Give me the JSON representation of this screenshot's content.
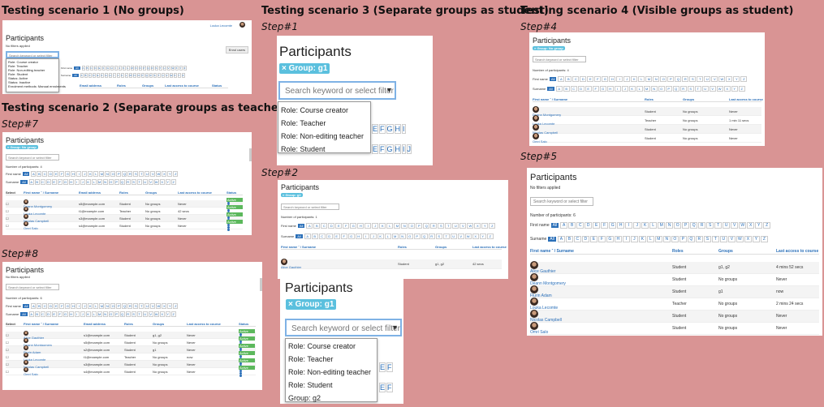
{
  "headings": {
    "s1": "Testing scenario 1 (No groups)",
    "s2": "Testing scenario 2 (Separate groups as teacher)",
    "s3": "Testing scenario 3 (Separate groups as student)",
    "s4": "Testing scenario 4 (Visible groups as student)"
  },
  "steps": {
    "s1": "Step#1",
    "s2": "Step#2",
    "s4": "Step#4",
    "s5": "Step#5",
    "s7": "Step#7",
    "s8": "Step#8"
  },
  "common": {
    "title": "Participants",
    "search_placeholder": "Search keyword or select filter",
    "no_filters": "No filters applied",
    "first_name": "First name",
    "surname": "Surname",
    "all": "All",
    "letters": [
      "A",
      "B",
      "C",
      "D",
      "E",
      "F",
      "G",
      "H",
      "I",
      "J",
      "K",
      "L",
      "M",
      "N",
      "O",
      "P",
      "Q",
      "R",
      "S",
      "T",
      "U",
      "V",
      "W",
      "X",
      "Y",
      "Z"
    ],
    "col_select": "Select",
    "col_name": "First name ˆ / Surname",
    "col_email": "Email address",
    "col_roles": "Roles",
    "col_groups": "Groups",
    "col_access": "Last access to course",
    "col_status": "Status",
    "active": "Active"
  },
  "s1": {
    "user": "Louka Lecomte",
    "enrol_btn": "Enrol users",
    "menu": [
      "Role: Course creator",
      "Role: Teacher",
      "Role: Non-editing teacher",
      "Role: Student",
      "Status: Active",
      "Status: Inactive",
      "Enrolment methods: Manual enrolments"
    ],
    "cols": [
      "Email address",
      "Roles",
      "Groups",
      "Last access to course",
      "Status"
    ]
  },
  "step1": {
    "badge": "× Group: g1",
    "menu": [
      "Role: Course creator",
      "Role: Teacher",
      "Role: Non-editing teacher",
      "Role: Student"
    ],
    "letters": [
      "E",
      "F",
      "G",
      "H",
      "I"
    ],
    "letters2": [
      "E",
      "F",
      "G",
      "H",
      "I",
      "J"
    ]
  },
  "step2": {
    "badge": "× Group: g2",
    "count": "Number of participants: 1",
    "rows": [
      {
        "name": "Alice Gauthier",
        "role": "Student",
        "groups": "g1, g2",
        "access": "42 secs"
      }
    ]
  },
  "step3": {
    "badge": "× Group: g1",
    "menu": [
      "Role: Course creator",
      "Role: Teacher",
      "Role: Non-editing teacher",
      "Role: Student",
      "Group: g2"
    ],
    "letters": [
      "E",
      "F"
    ],
    "letters2": [
      "E",
      "F"
    ]
  },
  "step4": {
    "badge": "× Group: No group",
    "count": "Number of participants: 4",
    "rows": [
      {
        "name": "Deann Montgomery",
        "role": "Student",
        "groups": "No groups",
        "access": "Never"
      },
      {
        "name": "Louka Lecomte",
        "role": "Teacher",
        "groups": "No groups",
        "access": "1 min 11 secs"
      },
      {
        "name": "Nicolas Campbell",
        "role": "Student",
        "groups": "No groups",
        "access": "Never"
      },
      {
        "name": "Omri Salo",
        "role": "Student",
        "groups": "No groups",
        "access": "Never"
      }
    ]
  },
  "step5": {
    "count": "Number of participants: 6",
    "rows": [
      {
        "name": "Alice Gauthier",
        "role": "Student",
        "groups": "g1, g2",
        "access": "4 mins 52 secs"
      },
      {
        "name": "Deann Montgomery",
        "role": "Student",
        "groups": "No groups",
        "access": "Never"
      },
      {
        "name": "Flurin Adam",
        "role": "Student",
        "groups": "g1",
        "access": "now"
      },
      {
        "name": "Louka Lecomte",
        "role": "Teacher",
        "groups": "No groups",
        "access": "2 mins 24 secs"
      },
      {
        "name": "Nicolas Campbell",
        "role": "Student",
        "groups": "No groups",
        "access": "Never"
      },
      {
        "name": "Omri Salo",
        "role": "Student",
        "groups": "No groups",
        "access": "Never"
      }
    ]
  },
  "step7": {
    "badge": "× Group: No group",
    "count": "Number of participants: 4",
    "rows": [
      {
        "name": "Deann Montgomery",
        "email": "s5@example.com",
        "role": "Student",
        "groups": "No groups",
        "access": "Never"
      },
      {
        "name": "Louka Lecomte",
        "email": "t1@example.com",
        "role": "Teacher",
        "groups": "No groups",
        "access": "42 secs"
      },
      {
        "name": "Nicolas Campbell",
        "email": "s3@example.com",
        "role": "Student",
        "groups": "No groups",
        "access": "Never"
      },
      {
        "name": "Omri Salo",
        "email": "s4@example.com",
        "role": "Student",
        "groups": "No groups",
        "access": "Never"
      }
    ]
  },
  "step8": {
    "count": "Number of participants: 6",
    "rows": [
      {
        "name": "Alice Gauthier",
        "email": "s1@example.com",
        "role": "Student",
        "groups": "g1, g2",
        "access": "Never"
      },
      {
        "name": "Deann Montgomery",
        "email": "s5@example.com",
        "role": "Student",
        "groups": "No groups",
        "access": "Never"
      },
      {
        "name": "Flurin Adam",
        "email": "s2@example.com",
        "role": "Student",
        "groups": "g1",
        "access": "Never"
      },
      {
        "name": "Louka Lecomte",
        "email": "t1@example.com",
        "role": "Teacher",
        "groups": "No groups",
        "access": "now"
      },
      {
        "name": "Nicolas Campbell",
        "email": "s3@example.com",
        "role": "Student",
        "groups": "No groups",
        "access": "Never"
      },
      {
        "name": "Omri Salo",
        "email": "s4@example.com",
        "role": "Student",
        "groups": "No groups",
        "access": "Never"
      }
    ]
  }
}
